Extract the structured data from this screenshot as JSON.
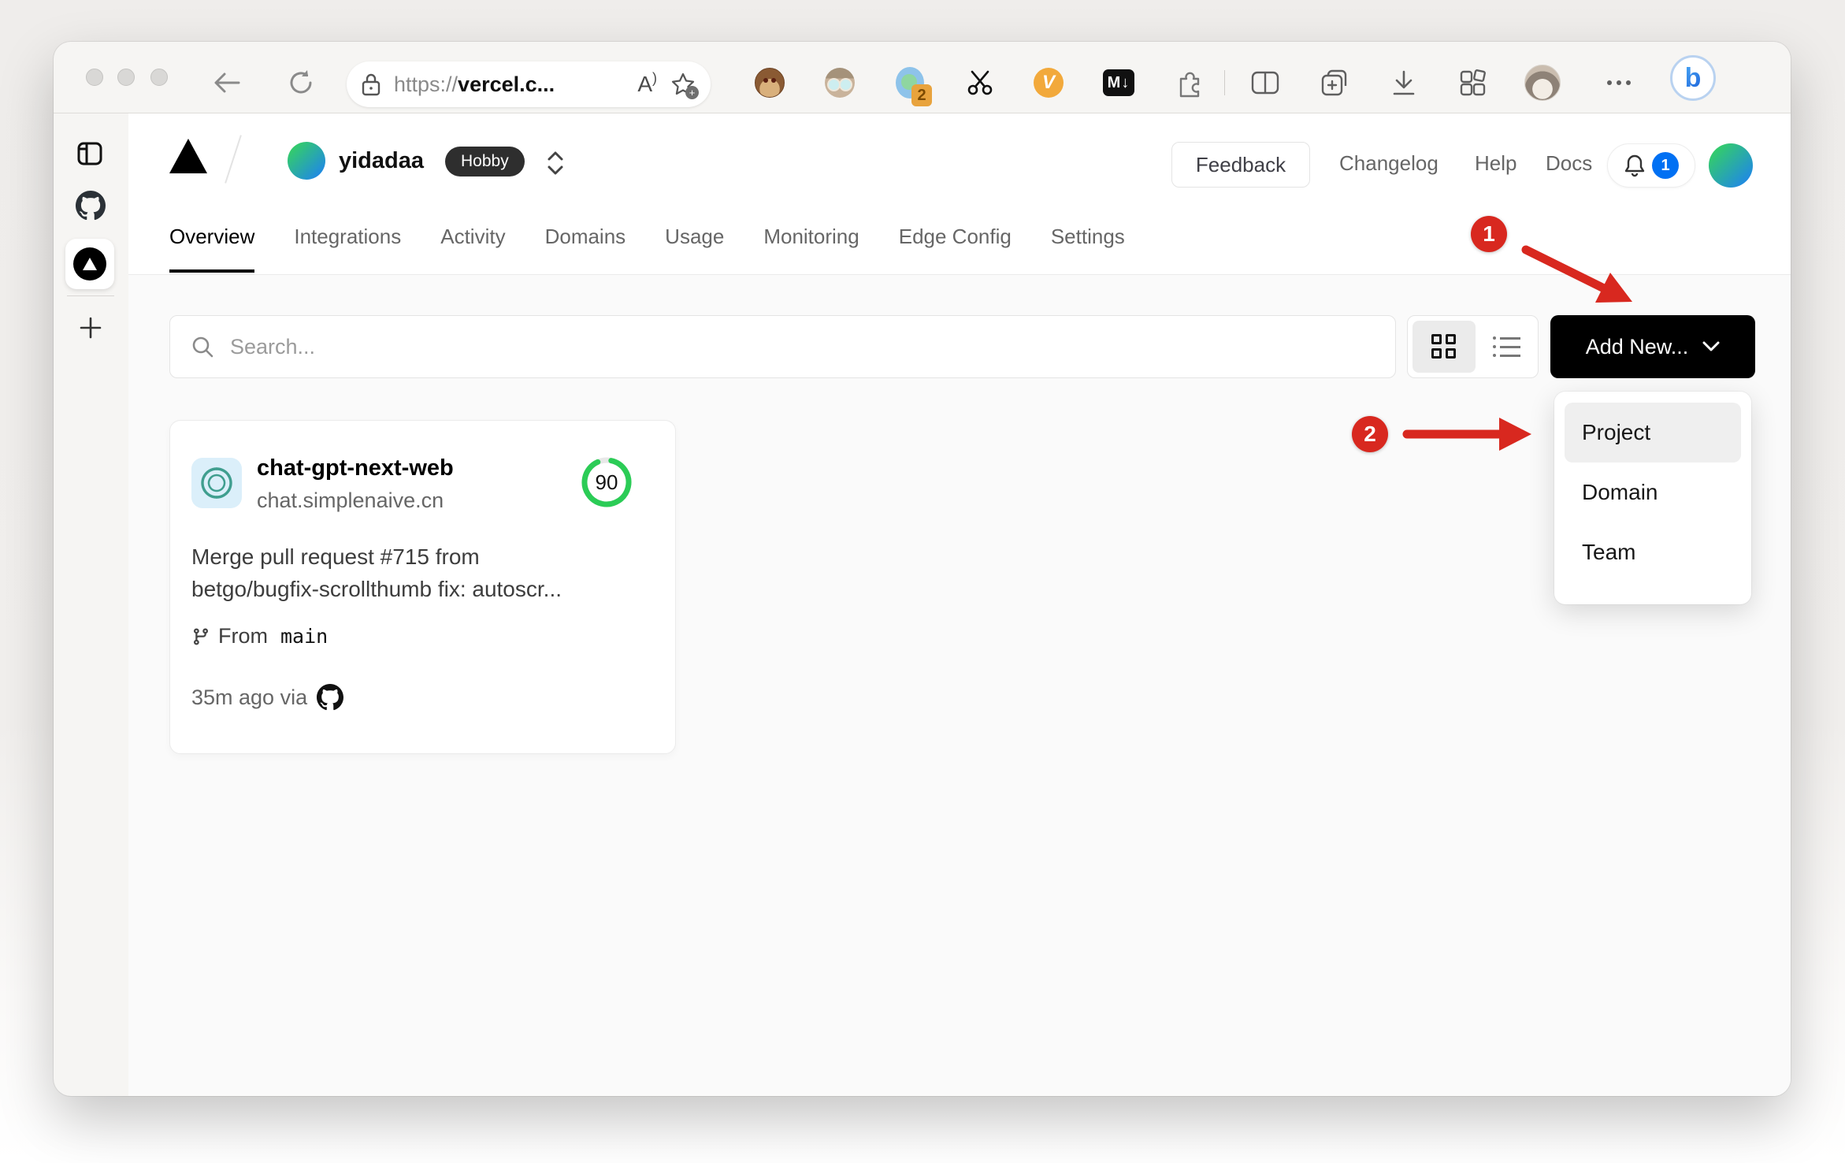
{
  "browser": {
    "address": {
      "scheme": "https://",
      "host_truncated": "vercel.c..."
    },
    "reader_glyph": "A",
    "extensions": {
      "translate_badge": "2",
      "v_glyph": "V",
      "markdown_glyph": "M↓"
    }
  },
  "vercel": {
    "breadcrumb": {
      "team": "yidadaa",
      "plan": "Hobby"
    },
    "header_links": [
      "Feedback",
      "Changelog",
      "Help",
      "Docs"
    ],
    "notification_count": "1",
    "tabs": [
      "Overview",
      "Integrations",
      "Activity",
      "Domains",
      "Usage",
      "Monitoring",
      "Edge Config",
      "Settings"
    ],
    "active_tab": "Overview",
    "controls": {
      "search_placeholder": "Search...",
      "add_new": "Add New..."
    },
    "project": {
      "name": "chat-gpt-next-web",
      "domain": "chat.simplenaive.cn",
      "score": "90",
      "commit_line1": "Merge pull request #715 from",
      "commit_line2": "betgo/bugfix-scrollthumb fix: autoscr...",
      "branch_prefix": "From",
      "branch": "main",
      "deployed": "35m ago via"
    },
    "menu": {
      "items": [
        "Project",
        "Domain",
        "Team"
      ],
      "highlighted": "Project"
    }
  },
  "annotations": {
    "step1": "1",
    "step2": "2"
  },
  "colors": {
    "annotation_red": "#d8281f",
    "score_green": "#2bcc56",
    "badge_blue": "#0070f3",
    "button_black": "#000000"
  }
}
